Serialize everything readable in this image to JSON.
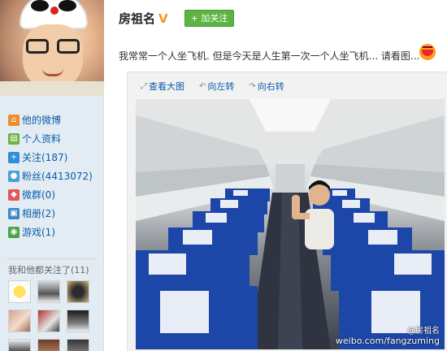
{
  "profile": {
    "name": "房祖名",
    "verified_icon": "v-badge-icon",
    "follow_button": "+ 加关注"
  },
  "sidebar": {
    "items": [
      {
        "label": "他的微博",
        "icon": "home-icon"
      },
      {
        "label": "个人资料",
        "icon": "profile-card-icon"
      },
      {
        "label": "关注(187)",
        "icon": "follow-icon"
      },
      {
        "label": "粉丝(4413072)",
        "icon": "fans-icon"
      },
      {
        "label": "微群(0)",
        "icon": "group-icon"
      },
      {
        "label": "相册(2)",
        "icon": "album-icon"
      },
      {
        "label": "游戏(1)",
        "icon": "game-icon"
      }
    ],
    "mutual_label": "我和他都关注了(11)"
  },
  "post": {
    "text": "我常常一个人坐飞机. 但是今天是人生第一次一个人坐飞机... 请看图...",
    "toolbar": {
      "view_large": "查看大图",
      "rotate_left": "向左转",
      "rotate_right": "向右转"
    },
    "watermark_name": "@房祖名",
    "watermark_url": "weibo.com/fangzuming"
  },
  "colors": {
    "link": "#0a5cad",
    "follow_btn": "#5cb443",
    "sidebar_bg": "#e3ecf2",
    "seat_blue": "#1c47a8"
  }
}
